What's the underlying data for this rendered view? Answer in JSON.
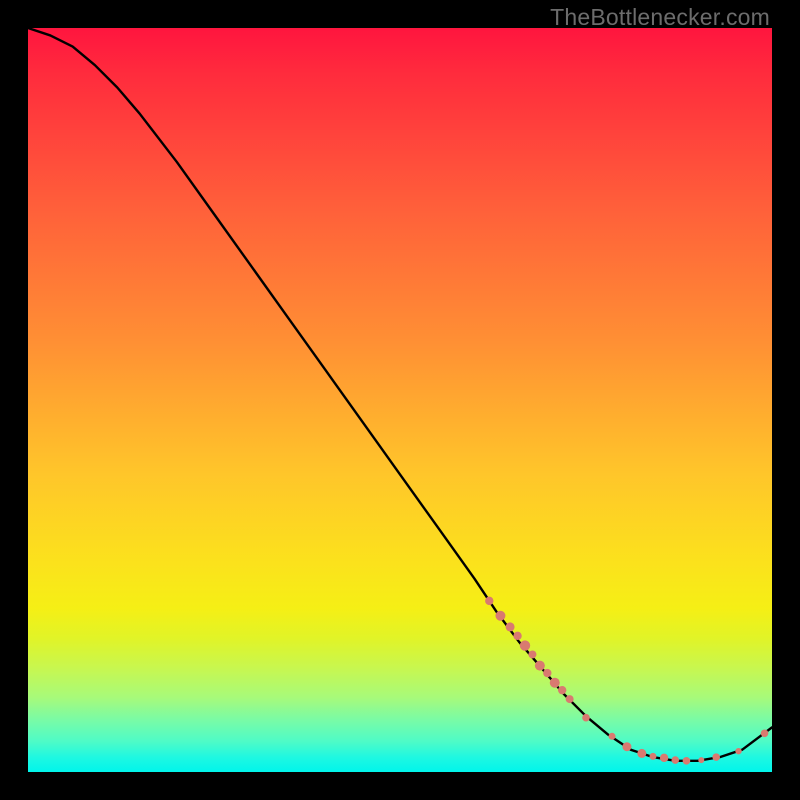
{
  "watermark": "TheBottlenecker.com",
  "chart_data": {
    "type": "line",
    "title": "",
    "xlabel": "",
    "ylabel": "",
    "xlim": [
      0,
      100
    ],
    "ylim": [
      0,
      100
    ],
    "gradient_stops": [
      {
        "offset": 0,
        "color": "#ff153e"
      },
      {
        "offset": 6,
        "color": "#ff2b3d"
      },
      {
        "offset": 24,
        "color": "#ff5f3a"
      },
      {
        "offset": 42,
        "color": "#ff8f34"
      },
      {
        "offset": 60,
        "color": "#ffc62a"
      },
      {
        "offset": 72,
        "color": "#fbe21c"
      },
      {
        "offset": 78,
        "color": "#f5ef15"
      },
      {
        "offset": 82,
        "color": "#e1f427"
      },
      {
        "offset": 86,
        "color": "#c8f74f"
      },
      {
        "offset": 90,
        "color": "#a7fa7a"
      },
      {
        "offset": 93,
        "color": "#79fba6"
      },
      {
        "offset": 96,
        "color": "#4cfbc8"
      },
      {
        "offset": 98,
        "color": "#1ff8e1"
      },
      {
        "offset": 100,
        "color": "#00f5eb"
      }
    ],
    "series": [
      {
        "name": "bottleneck-curve",
        "x": [
          0,
          3,
          6,
          9,
          12,
          15,
          20,
          25,
          30,
          35,
          40,
          45,
          50,
          55,
          60,
          63,
          66,
          69,
          72,
          75,
          78,
          81,
          84,
          87,
          90,
          93,
          96,
          100
        ],
        "y": [
          100,
          99,
          97.5,
          95,
          92,
          88.5,
          82,
          75,
          68,
          61,
          54,
          47,
          40,
          33,
          26,
          21.5,
          17.5,
          14,
          10.5,
          7.5,
          5,
          3,
          2,
          1.5,
          1.5,
          2,
          3,
          6
        ]
      }
    ],
    "markers": [
      {
        "name": "segment-markers",
        "color": "#d97a70",
        "points": [
          {
            "x": 62.0,
            "y": 23.0,
            "r": 4.2
          },
          {
            "x": 63.5,
            "y": 21.0,
            "r": 5.0
          },
          {
            "x": 64.8,
            "y": 19.5,
            "r": 4.5
          },
          {
            "x": 65.8,
            "y": 18.3,
            "r": 4.2
          },
          {
            "x": 66.8,
            "y": 17.0,
            "r": 5.2
          },
          {
            "x": 67.8,
            "y": 15.8,
            "r": 4.0
          },
          {
            "x": 68.8,
            "y": 14.3,
            "r": 5.0
          },
          {
            "x": 69.8,
            "y": 13.3,
            "r": 4.2
          },
          {
            "x": 70.8,
            "y": 12.0,
            "r": 5.0
          },
          {
            "x": 71.8,
            "y": 11.0,
            "r": 4.2
          },
          {
            "x": 72.8,
            "y": 9.8,
            "r": 4.0
          },
          {
            "x": 75.0,
            "y": 7.3,
            "r": 3.8
          },
          {
            "x": 78.5,
            "y": 4.8,
            "r": 3.5
          },
          {
            "x": 80.5,
            "y": 3.4,
            "r": 4.5
          },
          {
            "x": 82.5,
            "y": 2.5,
            "r": 4.5
          },
          {
            "x": 84.0,
            "y": 2.1,
            "r": 3.5
          },
          {
            "x": 85.5,
            "y": 1.9,
            "r": 4.2
          },
          {
            "x": 87.0,
            "y": 1.6,
            "r": 3.8
          },
          {
            "x": 88.5,
            "y": 1.5,
            "r": 3.8
          },
          {
            "x": 90.5,
            "y": 1.6,
            "r": 3.0
          },
          {
            "x": 92.5,
            "y": 2.0,
            "r": 3.8
          },
          {
            "x": 95.5,
            "y": 2.8,
            "r": 3.2
          },
          {
            "x": 99.0,
            "y": 5.2,
            "r": 3.8
          }
        ]
      }
    ]
  }
}
